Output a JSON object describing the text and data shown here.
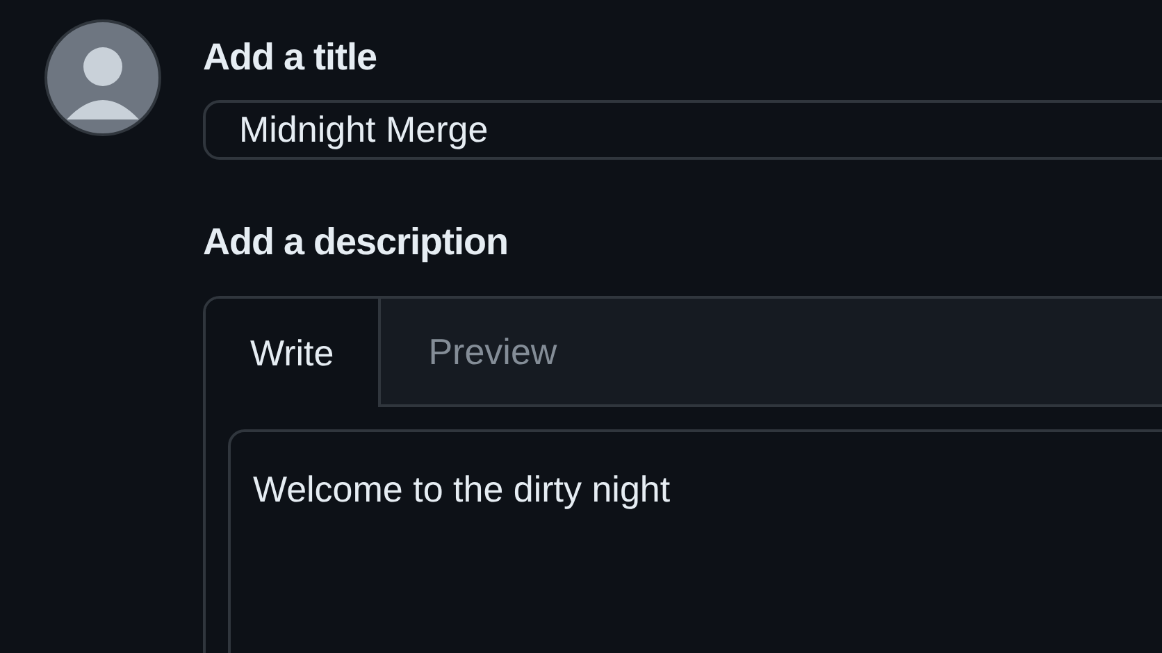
{
  "title_label": "Add a title",
  "title_field": {
    "value": "Midnight Merge"
  },
  "description_label": "Add a description",
  "tabs": [
    {
      "label": "Write",
      "selected": true
    },
    {
      "label": "Preview",
      "selected": false
    }
  ],
  "description_field": {
    "value": "Welcome to the dirty night"
  }
}
